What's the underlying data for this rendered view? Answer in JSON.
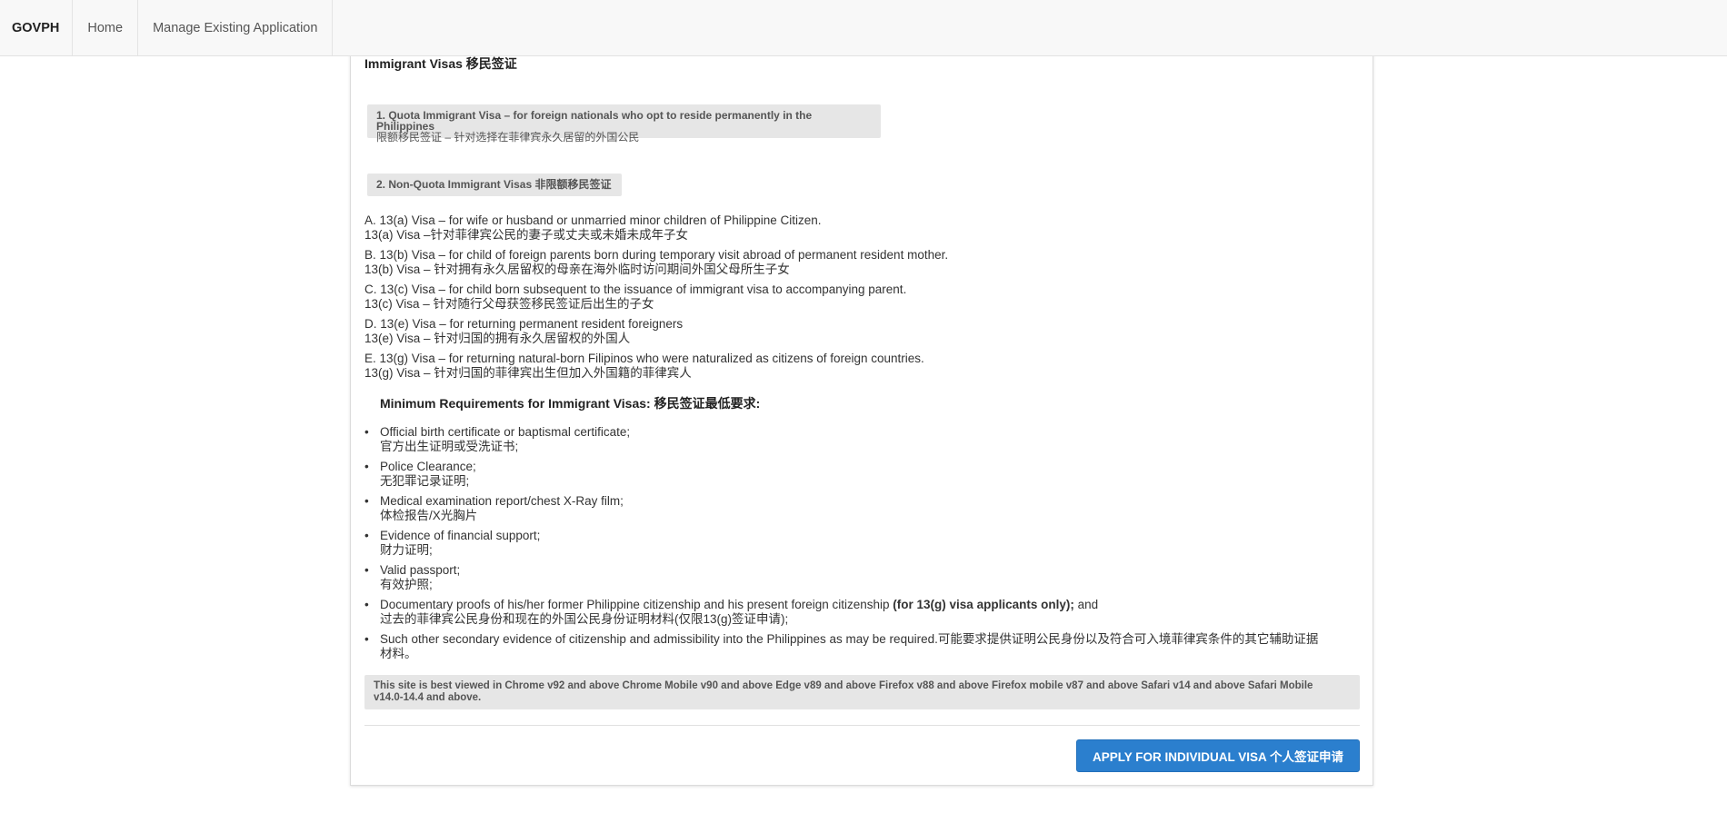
{
  "navbar": {
    "brand": "GOVPH",
    "links": [
      "Home",
      "Manage Existing Application"
    ]
  },
  "section_title": "Immigrant Visas 移民签证",
  "quota_box": {
    "line1": "1. Quota Immigrant Visa – for foreign nationals who opt to reside permanently in the Philippines",
    "line2": "限额移民签证 – 针对选择在菲律宾永久居留的外国公民"
  },
  "nonquota_box": "2. Non-Quota Immigrant Visas 非限额移民签证",
  "visas": [
    {
      "en": "A. 13(a) Visa – for wife or husband or unmarried minor children of Philippine Citizen.",
      "zh": "13(a) Visa –针对菲律宾公民的妻子或丈夫或未婚未成年子女"
    },
    {
      "en": "B. 13(b) Visa – for child of foreign parents born during temporary visit abroad of permanent resident mother.",
      "zh": "13(b) Visa – 针对拥有永久居留权的母亲在海外临时访问期间外国父母所生子女"
    },
    {
      "en": "C. 13(c) Visa – for child born subsequent to the issuance of immigrant visa to accompanying parent.",
      "zh": "13(c) Visa – 针对随行父母获签移民签证后出生的子女"
    },
    {
      "en": "D. 13(e) Visa – for returning permanent resident foreigners",
      "zh": "13(e) Visa – 针对归国的拥有永久居留权的外国人"
    },
    {
      "en": "E. 13(g) Visa – for returning natural-born Filipinos who were naturalized as citizens of foreign countries.",
      "zh": "13(g) Visa – 针对归国的菲律宾出生但加入外国籍的菲律宾人"
    }
  ],
  "requirements_heading": "Minimum Requirements for Immigrant Visas: 移民签证最低要求:",
  "requirements": [
    {
      "en": "Official birth certificate or baptismal certificate;",
      "zh": "官方出生证明或受洗证书;"
    },
    {
      "en": "Police Clearance;",
      "zh": "无犯罪记录证明;"
    },
    {
      "en": "Medical examination report/chest X-Ray film;",
      "zh": "体检报告/X光胸片"
    },
    {
      "en": "Evidence of financial support;",
      "zh": "财力证明;"
    },
    {
      "en": "Valid passport;",
      "zh": "有效护照;"
    }
  ],
  "req_documentary": {
    "prefix": "Documentary proofs of his/her former Philippine citizenship and his present foreign citizenship ",
    "bold": "(for 13(g) visa applicants only);",
    "suffix": " and",
    "zh": "过去的菲律宾公民身份和现在的外国公民身份证明材料(仅限13(g)签证申请);"
  },
  "req_other": {
    "line1": "Such other secondary evidence of citizenship and admissibility into the Philippines as may be required.可能要求提供证明公民身份以及符合可入境菲律宾条件的其它辅助证据",
    "line2": "材料。"
  },
  "browser_note": {
    "line1": "This site is best viewed in Chrome v92 and above Chrome Mobile v90 and above Edge v89 and above Firefox v88 and above Firefox mobile v87 and above Safari v14 and above Safari Mobile",
    "line2": "v14.0-14.4 and above."
  },
  "apply_button": "APPLY FOR INDIVIDUAL VISA 个人签证申请"
}
